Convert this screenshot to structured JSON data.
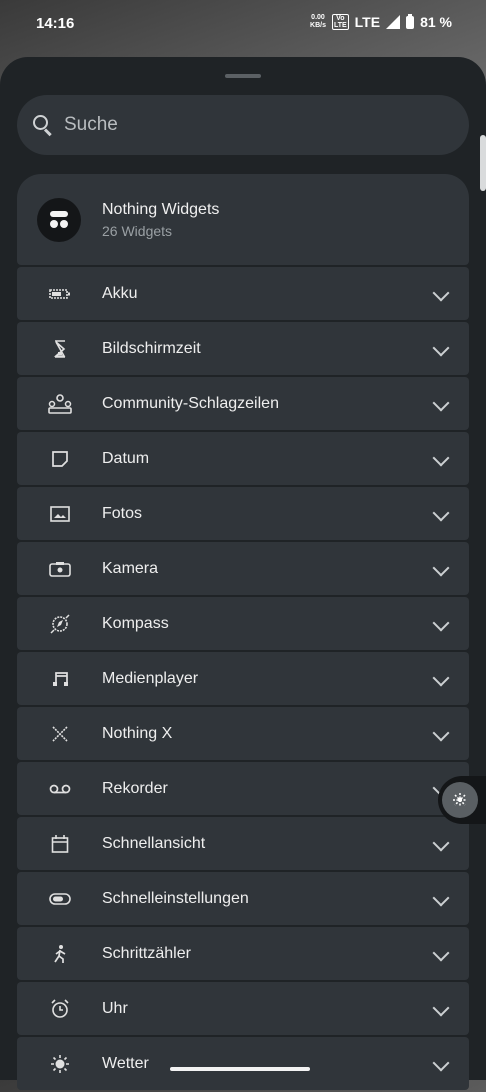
{
  "status": {
    "time": "14:16",
    "speed_value": "0.00",
    "speed_unit": "KB/s",
    "volte_top": "Vo",
    "volte_bottom": "LTE",
    "network": "LTE",
    "battery": "81 %"
  },
  "search": {
    "placeholder": "Suche"
  },
  "header": {
    "title": "Nothing Widgets",
    "subtitle": "26 Widgets"
  },
  "items": [
    {
      "label": "Akku",
      "icon": "battery-icon"
    },
    {
      "label": "Bildschirmzeit",
      "icon": "hourglass-icon"
    },
    {
      "label": "Community-Schlagzeilen",
      "icon": "community-icon"
    },
    {
      "label": "Datum",
      "icon": "date-icon"
    },
    {
      "label": "Fotos",
      "icon": "photo-icon"
    },
    {
      "label": "Kamera",
      "icon": "camera-icon"
    },
    {
      "label": "Kompass",
      "icon": "compass-icon"
    },
    {
      "label": "Medienplayer",
      "icon": "music-note-icon"
    },
    {
      "label": "Nothing X",
      "icon": "nothing-x-icon"
    },
    {
      "label": "Rekorder",
      "icon": "recorder-icon"
    },
    {
      "label": "Schnellansicht",
      "icon": "calendar-icon"
    },
    {
      "label": "Schnelleinstellungen",
      "icon": "toggle-icon"
    },
    {
      "label": "Schrittzähler",
      "icon": "walker-icon"
    },
    {
      "label": "Uhr",
      "icon": "alarm-clock-icon"
    },
    {
      "label": "Wetter",
      "icon": "sun-icon"
    }
  ]
}
